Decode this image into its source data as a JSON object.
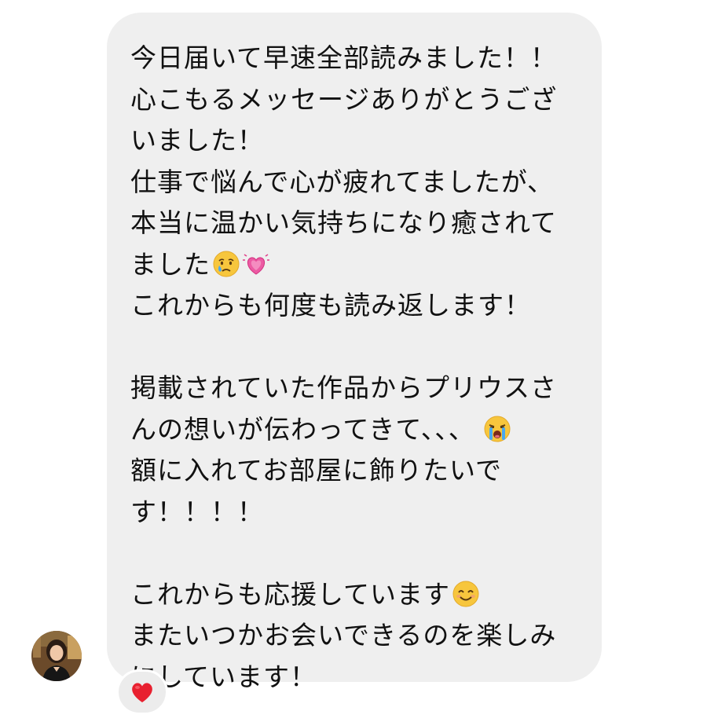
{
  "message": {
    "lines": [
      "今日届いて早速全部読みました！！",
      "心こもるメッセージありがとうござ",
      "いました！",
      "仕事で悩んで心が疲れてましたが、",
      "本当に温かい気持ちになり癒されて",
      "ました",
      "これからも何度も読み返します！",
      "",
      "掲載されていた作品からプリウスさ",
      "んの想いが伝わってきて、、、",
      "額に入れてお部屋に飾りたいで",
      "す！！！！",
      "",
      "これからも応援しています",
      "またいつかお会いできるのを楽しみ",
      "にしています！"
    ],
    "emojis": {
      "line_6": [
        "crying-face-emoji",
        "growing-heart-emoji"
      ],
      "line_10": [
        "loudly-crying-face-emoji"
      ],
      "line_14": [
        "smiling-face-emoji"
      ]
    }
  },
  "reaction": {
    "icon": "red-heart-icon",
    "color": "#e8202f"
  },
  "colors": {
    "bubble": "#efefef",
    "text": "#111111"
  }
}
